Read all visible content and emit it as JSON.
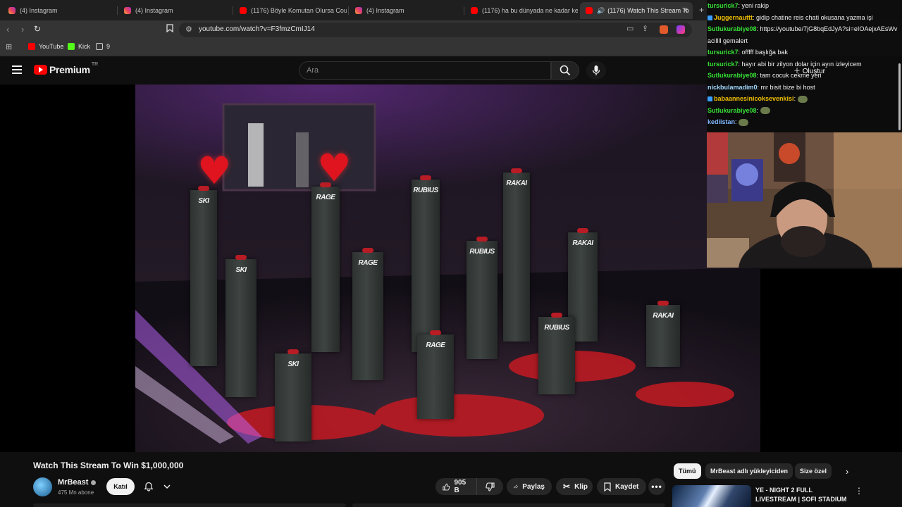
{
  "browser": {
    "tabs": [
      {
        "title": "(4) Instagram",
        "favicon": "instagram-icon"
      },
      {
        "title": "(4) Instagram",
        "favicon": "instagram-icon"
      },
      {
        "title": "(1176) Böyle Komutan Olursa Counte",
        "favicon": "youtube-icon"
      },
      {
        "title": "(4) Instagram",
        "favicon": "instagram-icon"
      },
      {
        "title": "(1176) ha bu dünyada ne kadar kedi",
        "favicon": "youtube-icon"
      },
      {
        "title": "(1176) Watch This Stream To",
        "favicon": "youtube-icon",
        "active": true
      }
    ],
    "url": "youtube.com/watch?v=F3fmzCmIJ14",
    "bookmarks": [
      {
        "label": "YouTube",
        "icon": "youtube-icon"
      },
      {
        "label": "Kick",
        "icon": "kick-icon"
      },
      {
        "label": "9",
        "icon": "folder-icon"
      }
    ]
  },
  "youtube": {
    "logo_text": "Premium",
    "country": "TR",
    "search_placeholder": "Ara",
    "create_label": "Oluştur"
  },
  "video": {
    "title": "Watch This Stream To Win $1,000,000",
    "channel": "MrBeast",
    "subscribers": "475 Mn abone",
    "join_label": "Katıl",
    "likes": "905 B",
    "share_label": "Paylaş",
    "clip_label": "Klip",
    "save_label": "Kaydet",
    "pillar_names": [
      "SKI",
      "RAGE",
      "RUBIUS",
      "RAKAI",
      "SKI",
      "RAGE",
      "RUBIUS",
      "RAKAI",
      "SKI",
      "RAGE",
      "RUBIUS",
      "RAKAI"
    ]
  },
  "recommendations": {
    "chips": [
      "Tümü",
      "MrBeast adlı yükleyiciden",
      "Size özel"
    ],
    "first_title": "YE - NIGHT 2 FULL LIVESTREAM | SOFI STADIUM"
  },
  "chat": {
    "messages": [
      {
        "user": "tursurick7",
        "color": "#36e036",
        "text": "yeni rakip"
      },
      {
        "user": "Juggernauttt",
        "color": "#f0c000",
        "text": "gidip chatine reis chati okusana yazma işi"
      },
      {
        "user": "Sutlukurabiye08",
        "color": "#36e036",
        "text": "https://youtube/7jG8bqEdJyA?si=eIOAejxAEsWv acillll gemalert"
      },
      {
        "user": "tursurick7",
        "color": "#36e036",
        "text": "offfff başlığa bak"
      },
      {
        "user": "tursurick7",
        "color": "#36e036",
        "text": "hayır abi bir zilyon dolar için ayın izleyicem"
      },
      {
        "user": "Sutlukurabiye08",
        "color": "#36e036",
        "text": "tam cocuk cekme yeri"
      },
      {
        "user": "nickbulamadim0",
        "color": "#a0d8ff",
        "text": "mr bisit bize bi host"
      },
      {
        "user": "babaannesinicoksevenkisi",
        "color": "#f0c000",
        "text": ""
      },
      {
        "user": "Sutlukurabiye08",
        "color": "#36e036",
        "text": ""
      },
      {
        "user": "kediistan",
        "color": "#7fb8ff",
        "text": ""
      }
    ]
  },
  "colors": {
    "yt_red": "#ff0000",
    "background": "#0f0f0f",
    "chip_bg": "#272727"
  }
}
